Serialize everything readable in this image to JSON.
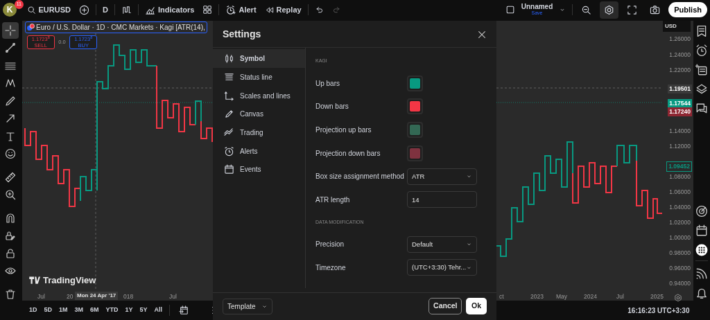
{
  "top_bar": {
    "avatar": "K",
    "notifications": "11",
    "symbol": "EURUSD",
    "interval": "D",
    "indicators": "Indicators",
    "alert": "Alert",
    "replay": "Replay",
    "layout_name": "Unnamed",
    "save": "Save",
    "publish": "Publish",
    "tools": [
      {
        "kind": "zoom",
        "selected": false
      },
      {
        "kind": "settings",
        "selected": true
      },
      {
        "kind": "fullscreen",
        "selected": false
      },
      {
        "kind": "camera",
        "selected": false
      }
    ]
  },
  "left_toolbar": [
    {
      "kind": "crosshair",
      "selected": true
    },
    {
      "kind": "trend-line",
      "selected": false
    },
    {
      "kind": "lines",
      "selected": false
    },
    {
      "kind": "pattern",
      "selected": false
    },
    {
      "kind": "brush",
      "selected": false
    },
    {
      "kind": "arrow",
      "selected": false
    },
    {
      "kind": "text",
      "selected": false
    },
    {
      "kind": "smiley",
      "selected": false
    },
    {
      "kind": "ruler",
      "selected": false
    },
    {
      "kind": "zoom-in",
      "selected": false
    },
    {
      "kind": "magnet",
      "selected": false
    },
    {
      "kind": "lock-pencil",
      "selected": false
    },
    {
      "kind": "lock",
      "selected": false
    },
    {
      "kind": "eye",
      "selected": false
    },
    {
      "kind": "trash",
      "selected": false
    }
  ],
  "legend": {
    "title": "Euro / U.S. Dollar · 1D · CMC Markets · Kagi [ATR(14),",
    "sell_price": "1.1723$^{8}$",
    "sell": "SELL",
    "spread": "0.0",
    "buy_price": "1.1723$^{8}$",
    "buy": "BUY"
  },
  "logo": "TradingView",
  "price_axis": {
    "currency": "USD",
    "labels": [
      "1.26000",
      "1.24000",
      "1.22000",
      "1.14000",
      "1.12000",
      "1.08000",
      "1.06000",
      "1.04000",
      "1.02000",
      "1.00000",
      "0.98000",
      "0.96000",
      "0.94000"
    ],
    "markers": [
      {
        "kind": "crosshair",
        "text": "1.19501"
      },
      {
        "kind": "ask",
        "text": "1.17544"
      },
      {
        "kind": "bid",
        "text": "1.17240"
      },
      {
        "kind": "outline",
        "text": "1.09452"
      }
    ]
  },
  "time_axis": {
    "labels": [
      "Jul",
      "20",
      "018",
      "Jul",
      "ct",
      "2023",
      "May",
      "2024",
      "Jul",
      "2025"
    ],
    "crosshair_label": "Mon 24 Apr '17"
  },
  "bottom_bar": {
    "ranges": [
      "1D",
      "5D",
      "1M",
      "3M",
      "6M",
      "YTD",
      "1Y",
      "5Y",
      "All"
    ],
    "clock": "16:16:23 UTC+3:30"
  },
  "right_sidebar": [
    {
      "kind": "watchlist"
    },
    {
      "kind": "alarm"
    },
    {
      "kind": "add-list"
    },
    {
      "kind": "layers"
    },
    {
      "kind": "chat"
    },
    {
      "kind": "target"
    },
    {
      "kind": "calendar"
    },
    {
      "kind": "apps"
    },
    {
      "kind": "signal"
    },
    {
      "kind": "bell"
    }
  ],
  "settings_dialog": {
    "title": "Settings",
    "nav": [
      {
        "kind": "symbol",
        "label": "Symbol",
        "selected": true
      },
      {
        "kind": "status",
        "label": "Status line",
        "selected": false
      },
      {
        "kind": "scales",
        "label": "Scales and lines",
        "selected": false
      },
      {
        "kind": "canvas",
        "label": "Canvas",
        "selected": false
      },
      {
        "kind": "trading",
        "label": "Trading",
        "selected": false
      },
      {
        "kind": "alerts",
        "label": "Alerts",
        "selected": false
      },
      {
        "kind": "events",
        "label": "Events",
        "selected": false
      }
    ],
    "sections": [
      {
        "heading": "KAGI",
        "rows": [
          {
            "kind": "color",
            "label": "Up bars",
            "color": "#089981"
          },
          {
            "kind": "color",
            "label": "Down bars",
            "color": "#f23645"
          },
          {
            "kind": "color",
            "label": "Projection up bars",
            "color": "#336854"
          },
          {
            "kind": "color",
            "label": "Projection down bars",
            "color": "#7f323f"
          },
          {
            "kind": "select",
            "label": "Box size assignment method",
            "value": "ATR"
          },
          {
            "kind": "input",
            "label": "ATR length",
            "value": "14"
          }
        ]
      },
      {
        "heading": "DATA MODIFICATION",
        "rows": [
          {
            "kind": "select",
            "label": "Precision",
            "value": "Default"
          },
          {
            "kind": "select",
            "label": "Timezone",
            "value": "(UTC+3:30) Tehr..."
          }
        ]
      }
    ],
    "template": "Template",
    "cancel": "Cancel",
    "ok": "Ok"
  }
}
